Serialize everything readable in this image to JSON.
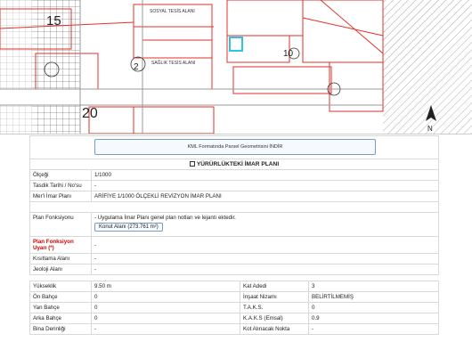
{
  "map": {
    "labels": {
      "block15": "15",
      "block20": "20",
      "block10": "10",
      "block2": "2",
      "saglik": "SAĞLIK TESİS ALANI",
      "sosyal": "SOSYAL TESİS ALANI",
      "north": "N"
    },
    "colors": {
      "parcel": "#e0302a",
      "road": "#999999",
      "highlight": "#2ec4e0",
      "hatch": "#333333"
    }
  },
  "kml_button": "KML Formatında Parsel Geometrisini İNDİR",
  "plan_section": {
    "title": "YÜRÜRLÜKTEKİ İMAR PLANI",
    "rows": [
      {
        "label": "Ölçeği",
        "value": "1/1000"
      },
      {
        "label": "Tasdik Tarihi / No'su",
        "value": "-"
      },
      {
        "label": "Mer'i İmar Planı",
        "value": "ARİFİYE 1/1000 ÖLÇEKLİ REVİZYON İMAR PLANI"
      }
    ]
  },
  "function_section": {
    "plan_fonksiyonu_label": "Plan Fonksiyonu",
    "plan_fonksiyonu_text": "- Uygulama İmar Planı genel plan notları ve lejantı ektedir.",
    "konut_button": "Konut Alanı (273.761 m²)",
    "uyan_label": "Plan Fonksiyon Uyarı (*)",
    "uyan_value": "-",
    "kisitlama_label": "Kısıtlama Alanı",
    "kisitlama_value": "-",
    "jeoloji_label": "Jeoloji Alanı",
    "jeoloji_value": "-"
  },
  "details": {
    "left": [
      {
        "label": "Yükseklik",
        "value": "9.50 m"
      },
      {
        "label": "Ön Bahçe",
        "value": "0"
      },
      {
        "label": "Yan Bahçe",
        "value": "0"
      },
      {
        "label": "Arka Bahçe",
        "value": "0"
      },
      {
        "label": "Bina Derinliği",
        "value": "-"
      }
    ],
    "right": [
      {
        "label": "Kat Adedi",
        "value": "3"
      },
      {
        "label": "İnşaat Nizamı",
        "value": "BELİRTİLMEMİŞ"
      },
      {
        "label": "T.A.K.S.",
        "value": "0"
      },
      {
        "label": "K.A.K.S (Emsal)",
        "value": "0.9"
      },
      {
        "label": "Kot Alınacak Nokta",
        "value": "-"
      }
    ]
  }
}
